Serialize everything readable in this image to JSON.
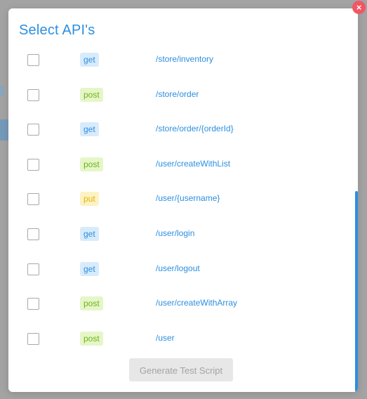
{
  "dialog": {
    "title": "Select API's",
    "close_symbol": "×",
    "generate_label": "Generate Test Script"
  },
  "apis": [
    {
      "method": "get",
      "path": "/store/inventory"
    },
    {
      "method": "post",
      "path": "/store/order"
    },
    {
      "method": "get",
      "path": "/store/order/{orderId}"
    },
    {
      "method": "post",
      "path": "/user/createWithList"
    },
    {
      "method": "put",
      "path": "/user/{username}"
    },
    {
      "method": "get",
      "path": "/user/login"
    },
    {
      "method": "get",
      "path": "/user/logout"
    },
    {
      "method": "post",
      "path": "/user/createWithArray"
    },
    {
      "method": "post",
      "path": "/user"
    }
  ],
  "colors": {
    "accent": "#2b8fe0",
    "close": "#f25663",
    "get_bg": "#d7ebfb",
    "post_bg": "#e6f6c8",
    "put_bg": "#fdf2c2"
  }
}
